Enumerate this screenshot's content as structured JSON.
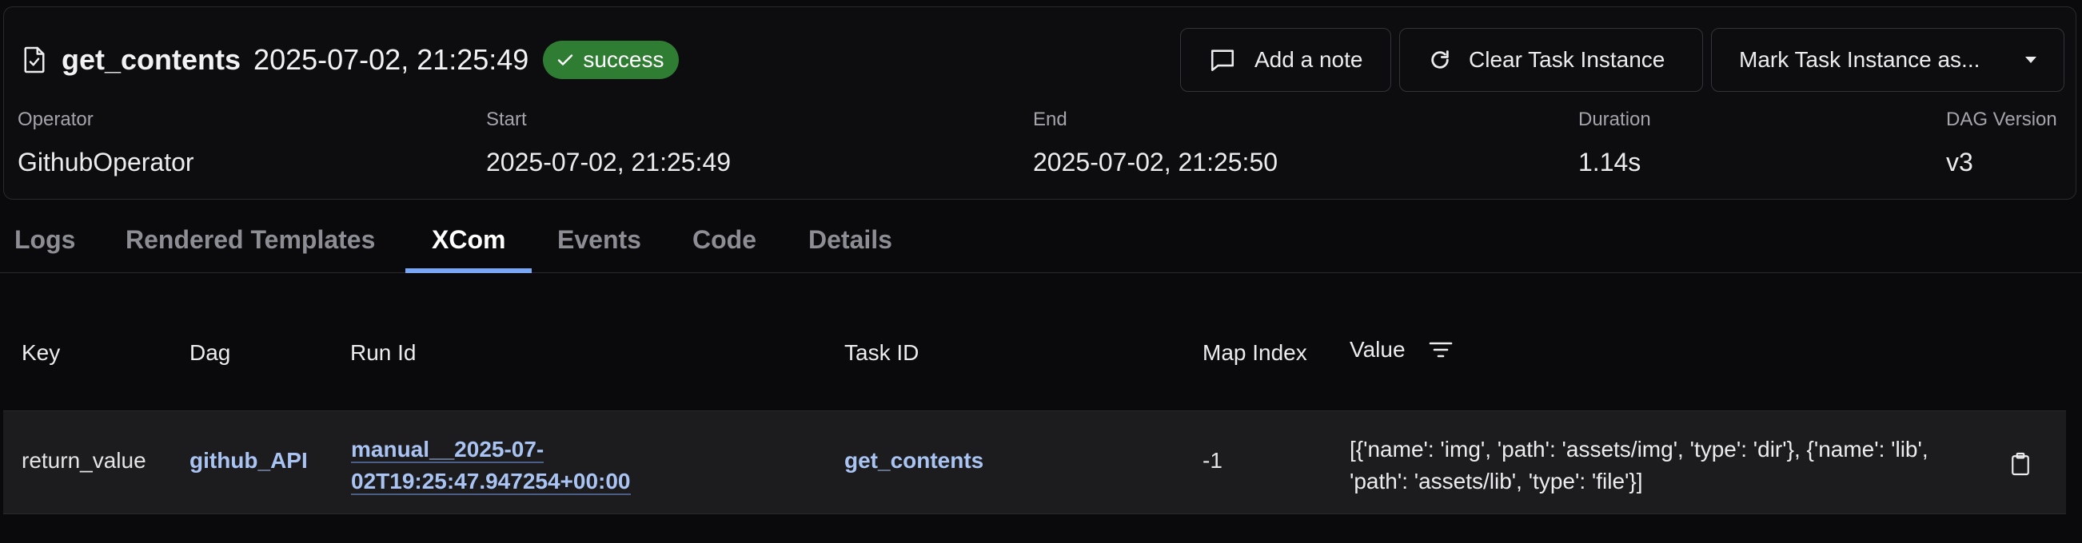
{
  "header": {
    "task_name": "get_contents",
    "task_date": "2025-07-02, 21:25:49",
    "status": "success",
    "status_color": "#2f7d32",
    "title_icon": "file-check-icon"
  },
  "actions": {
    "add_note": "Add a note",
    "clear_task_instance": "Clear Task Instance",
    "mark_task_instance": "Mark Task Instance as..."
  },
  "info": {
    "operator_label": "Operator",
    "operator_value": "GithubOperator",
    "start_label": "Start",
    "start_value": "2025-07-02, 21:25:49",
    "end_label": "End",
    "end_value": "2025-07-02, 21:25:50",
    "duration_label": "Duration",
    "duration_value": "1.14s",
    "dag_version_label": "DAG Version",
    "dag_version_value": "v3"
  },
  "tabs": [
    {
      "label": "Logs"
    },
    {
      "label": "Rendered Templates"
    },
    {
      "label": "XCom",
      "active": true
    },
    {
      "label": "Events"
    },
    {
      "label": "Code"
    },
    {
      "label": "Details"
    }
  ],
  "table": {
    "columns": [
      "Key",
      "Dag",
      "Run Id",
      "Task ID",
      "Map Index",
      "Value"
    ],
    "rows": [
      {
        "key": "return_value",
        "dag": "github_API",
        "run_id_line1": "manual__2025-07-",
        "run_id_line2": "02T19:25:47.947254+00:00",
        "task_id": "get_contents",
        "map_index": "-1",
        "value": "[{'name': 'img', 'path': 'assets/img', 'type': 'dir'}, {'name': 'lib', 'path': 'assets/lib', 'type': 'file'}]"
      }
    ]
  },
  "colors": {
    "link": "#a9c4f3",
    "tab_active_underline": "#7aa6f4",
    "background": "#0a0a0c"
  }
}
